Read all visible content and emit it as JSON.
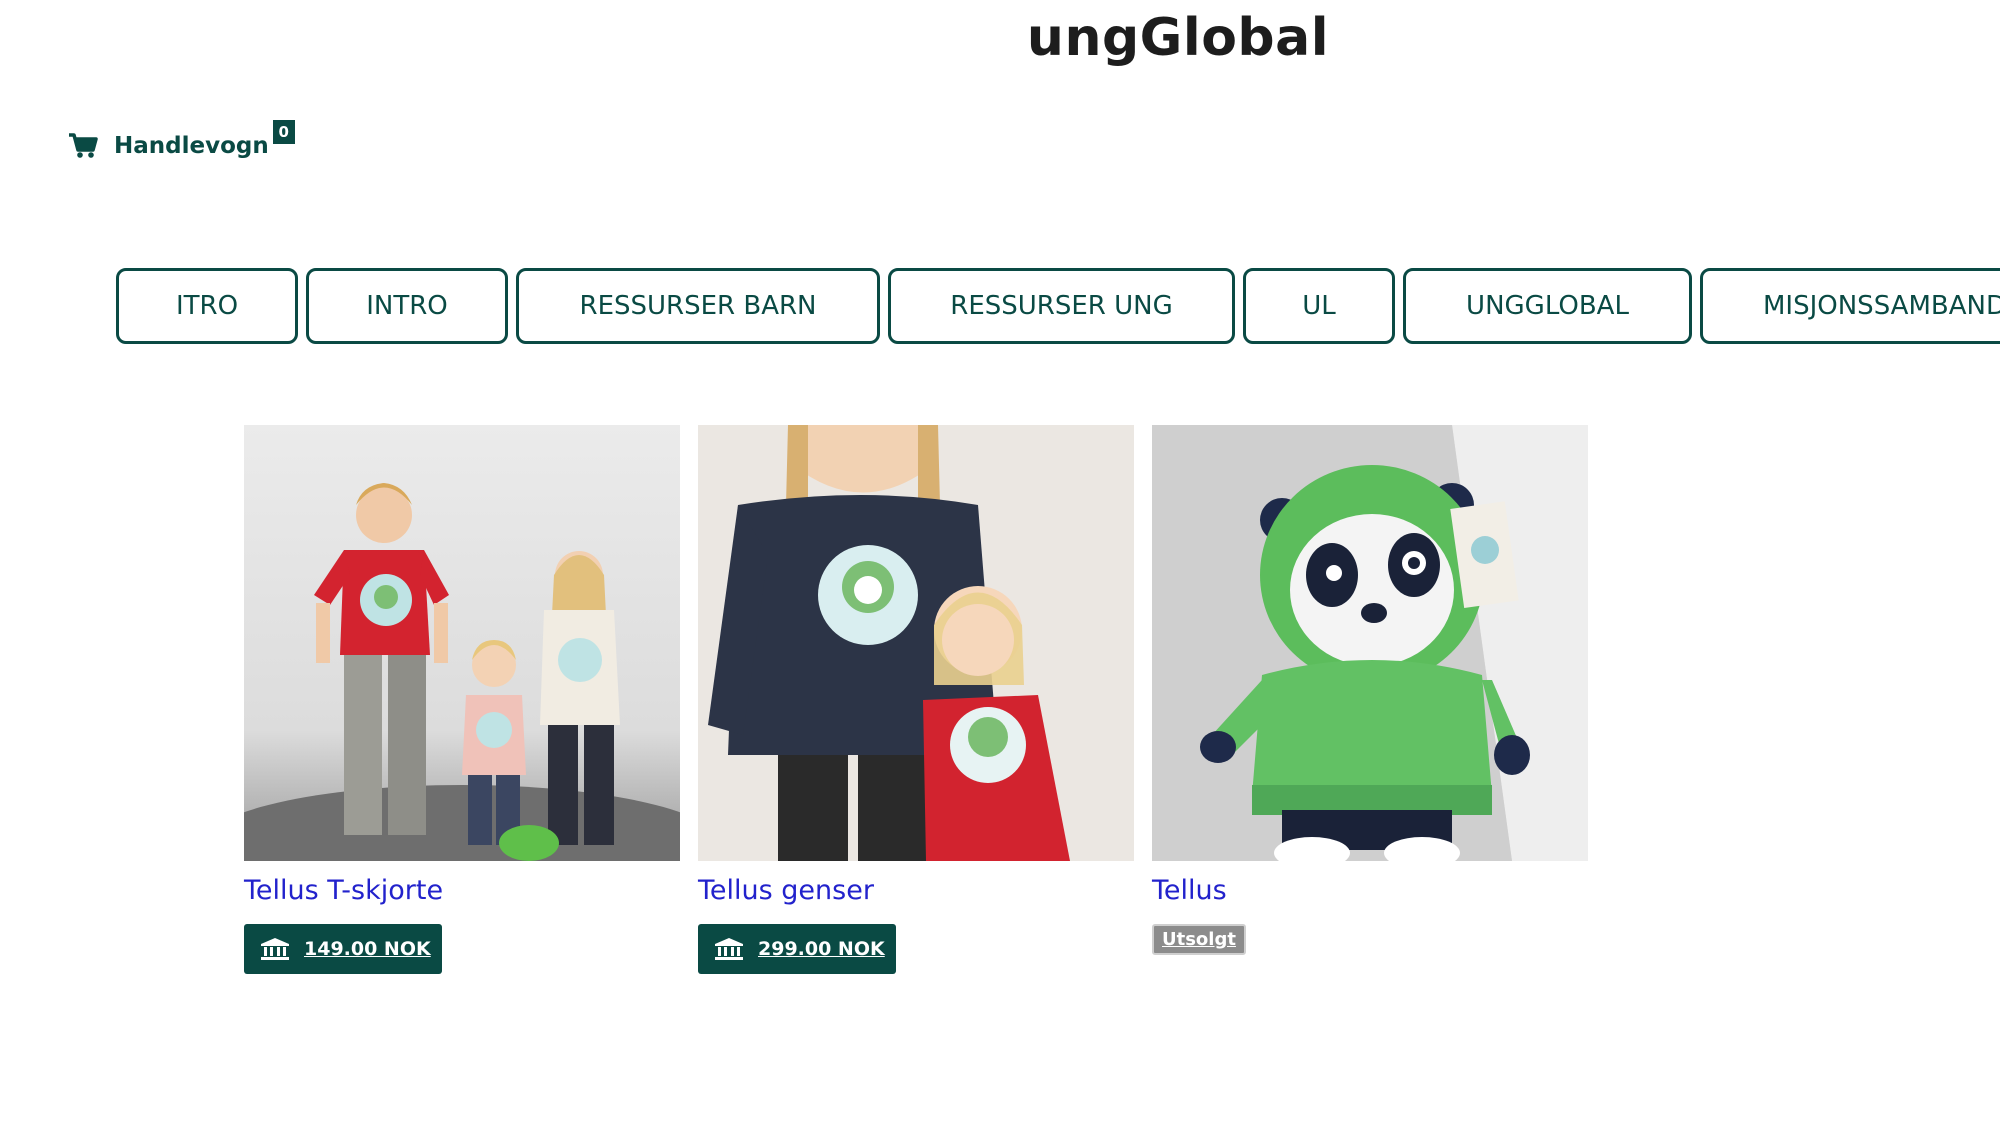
{
  "header": {
    "site_title": "ungGlobal"
  },
  "cart": {
    "label": "Handlevogn",
    "count": "0",
    "icon": "cart-icon"
  },
  "nav": {
    "items": [
      {
        "label": "ITRO"
      },
      {
        "label": "INTRO"
      },
      {
        "label": "RESSURSER BARN"
      },
      {
        "label": "RESSURSER UNG"
      },
      {
        "label": "UL"
      },
      {
        "label": "UNGGLOBAL"
      },
      {
        "label": "MISJONSSAMBANDET"
      }
    ]
  },
  "products": [
    {
      "title": "Tellus T-skjorte",
      "price": "149.00 NOK",
      "image": "kids-in-tshirts-photo",
      "available": true
    },
    {
      "title": "Tellus genser",
      "price": "299.00 NOK",
      "image": "kids-in-sweaters-photo",
      "available": true
    },
    {
      "title": "Tellus",
      "status": "Utsolgt",
      "image": "panda-plush-photo",
      "available": false
    }
  ],
  "colors": {
    "primary": "#0a4a44",
    "link": "#2222cc",
    "soldout": "#8c8c8c"
  }
}
